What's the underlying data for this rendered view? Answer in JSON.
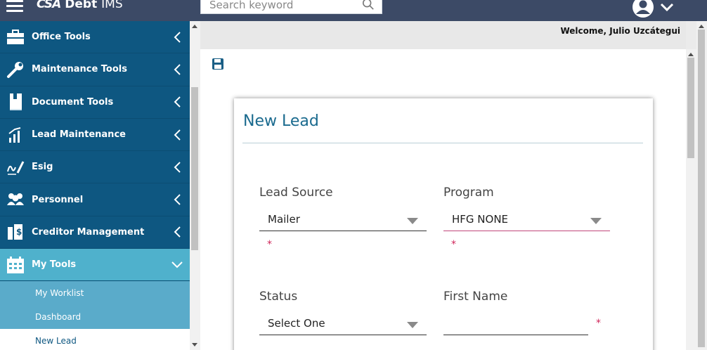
{
  "header": {
    "logo_mark": "CSA",
    "app_name": "Debt",
    "app_suffix": "IMS",
    "search_placeholder": "Search keyword"
  },
  "welcome": "Welcome, Julio Uzcátegui",
  "sidebar": {
    "items": [
      {
        "label": "Office Tools",
        "icon": "briefcase-icon"
      },
      {
        "label": "Maintenance Tools",
        "icon": "wrench-icon"
      },
      {
        "label": "Document Tools",
        "icon": "book-icon"
      },
      {
        "label": "Lead Maintenance",
        "icon": "chart-icon"
      },
      {
        "label": "Esig",
        "icon": "signature-icon"
      },
      {
        "label": "Personnel",
        "icon": "users-icon"
      },
      {
        "label": "Creditor Management",
        "icon": "ledger-icon"
      },
      {
        "label": "My Tools",
        "icon": "calendar-icon"
      }
    ],
    "sub_items": [
      "My Worklist",
      "Dashboard",
      "New Lead"
    ]
  },
  "form": {
    "title": "New Lead",
    "lead_source": {
      "label": "Lead Source",
      "value": "Mailer"
    },
    "program": {
      "label": "Program",
      "value": "HFG NONE"
    },
    "status": {
      "label": "Status",
      "value": "Select One"
    },
    "first_name": {
      "label": "First Name",
      "value": ""
    },
    "required_mark": "*"
  },
  "colors": {
    "topbar": "#3c4a66",
    "sidebar": "#0e5781",
    "active": "#4fb1cc",
    "title": "#1a6a8e",
    "required": "#d0265a"
  }
}
